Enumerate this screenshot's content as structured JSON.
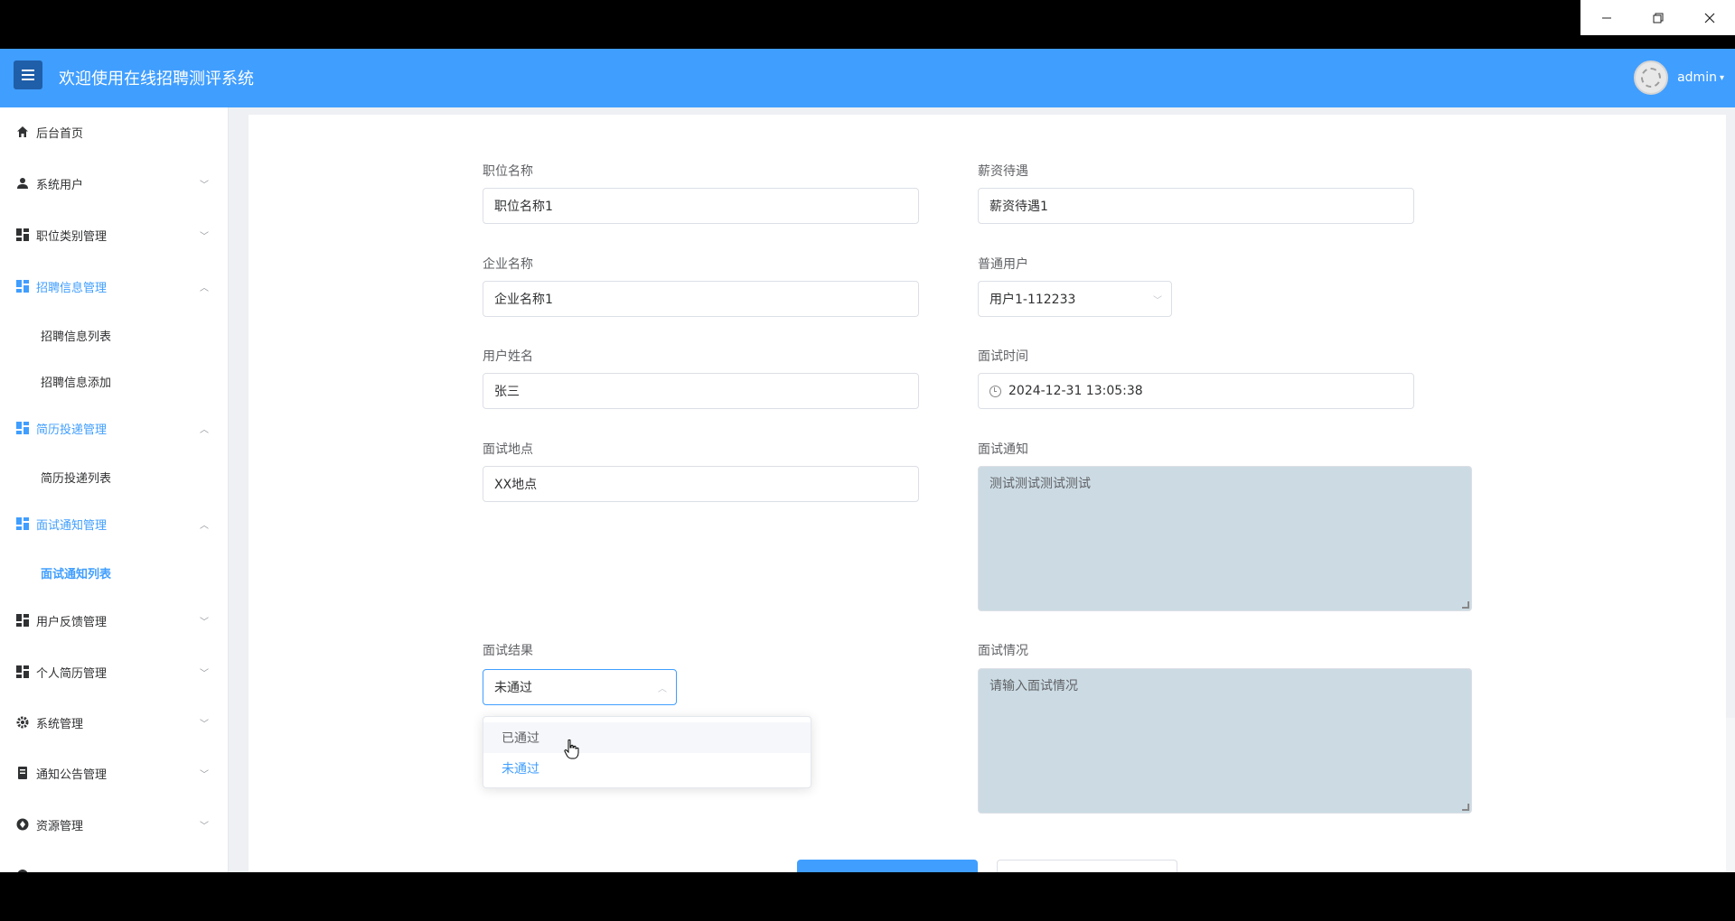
{
  "header": {
    "title": "欢迎使用在线招聘测评系统",
    "user_name": "admin"
  },
  "sidebar": {
    "items": [
      {
        "label": "后台首页",
        "icon": "home-icon"
      },
      {
        "label": "系统用户",
        "icon": "user-icon"
      },
      {
        "label": "职位类别管理",
        "icon": "grid-icon"
      },
      {
        "label": "招聘信息管理",
        "icon": "grid-icon"
      },
      {
        "label": "招聘信息列表"
      },
      {
        "label": "招聘信息添加"
      },
      {
        "label": "简历投递管理",
        "icon": "grid-icon"
      },
      {
        "label": "简历投递列表"
      },
      {
        "label": "面试通知管理",
        "icon": "grid-icon"
      },
      {
        "label": "面试通知列表"
      },
      {
        "label": "用户反馈管理",
        "icon": "grid-icon"
      },
      {
        "label": "个人简历管理",
        "icon": "grid-icon"
      },
      {
        "label": "系统管理",
        "icon": "gear-icon"
      },
      {
        "label": "通知公告管理",
        "icon": "notice-icon"
      },
      {
        "label": "资源管理",
        "icon": "resource-icon"
      }
    ]
  },
  "form": {
    "position_name": {
      "label": "职位名称",
      "value": "职位名称1"
    },
    "salary": {
      "label": "薪资待遇",
      "value": "薪资待遇1"
    },
    "company_name": {
      "label": "企业名称",
      "value": "企业名称1"
    },
    "normal_user": {
      "label": "普通用户",
      "value": "用户1-112233"
    },
    "user_name": {
      "label": "用户姓名",
      "value": "张三"
    },
    "interview_time": {
      "label": "面试时间",
      "value": "2024-12-31 13:05:38"
    },
    "interview_location": {
      "label": "面试地点",
      "value": "XX地点"
    },
    "interview_notice": {
      "label": "面试通知",
      "value": "测试测试测试测试"
    },
    "interview_result": {
      "label": "面试结果",
      "value": "未通过"
    },
    "interview_situation": {
      "label": "面试情况",
      "placeholder": "请输入面试情况"
    }
  },
  "dropdown": {
    "options": [
      "已通过",
      "未通过"
    ],
    "selected": "未通过",
    "hovered": "已通过"
  },
  "colors": {
    "primary": "#409eff",
    "textarea_bg": "#ccdbe3"
  }
}
